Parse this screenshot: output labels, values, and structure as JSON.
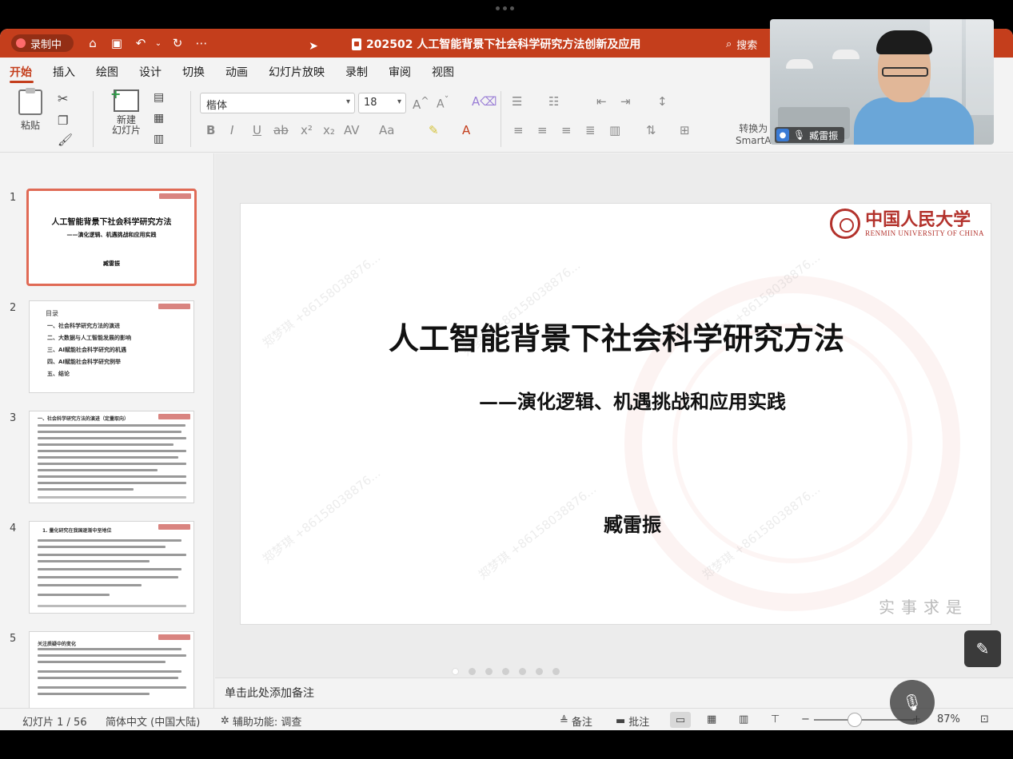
{
  "titlebar": {
    "recording_label": "录制中",
    "doc_title": "202502 人工智能背景下社会科学研究方法创新及应用",
    "search_label": "搜索"
  },
  "tabs": [
    "开始",
    "插入",
    "绘图",
    "设计",
    "切换",
    "动画",
    "幻灯片放映",
    "录制",
    "审阅",
    "视图"
  ],
  "ribbon": {
    "paste_label": "粘贴",
    "new_slide_label": "新建\n幻灯片",
    "font_name": "楷体",
    "font_size": "18",
    "convert_label": "转换为",
    "smartart_label": "SmartA"
  },
  "video": {
    "participant_name": "臧雷振"
  },
  "thumbnails": [
    {
      "num": "1",
      "title": "人工智能背景下社会科学研究方法",
      "subtitle": "——演化逻辑、机遇挑战和应用实践",
      "author": "臧雷振"
    },
    {
      "num": "2",
      "title": "目录",
      "items": [
        "一、社会科学研究方法的演进",
        "二、大数据与人工智能发展的影响",
        "三、AI赋能社会科学研究的机遇",
        "四、AI赋能社会科学研究例举",
        "五、结论"
      ]
    },
    {
      "num": "3",
      "title": "一、社会科学研究方法的演进（定量取向）"
    },
    {
      "num": "4",
      "title": "1. 量化研究在我国逐渐中坚地位"
    },
    {
      "num": "5",
      "title": "关注质疑中的变化"
    }
  ],
  "slide": {
    "university_cn": "中国人民大学",
    "university_en": "RENMIN UNIVERSITY OF CHINA",
    "title": "人工智能背景下社会科学研究方法",
    "subtitle": "——演化逻辑、机遇挑战和应用实践",
    "author": "臧雷振",
    "motto": "实事求是",
    "watermark_name": "郑梦琪",
    "watermark_phone": "+8615803887​6..."
  },
  "notes_placeholder": "单击此处添加备注",
  "status": {
    "slide_counter": "幻灯片 1 / 56",
    "language": "简体中文 (中国大陆)",
    "accessibility": "辅助功能: 调查",
    "notes_label": "备注",
    "comments_label": "批注",
    "zoom_percent": "87%"
  },
  "colors": {
    "accent": "#c43e1c",
    "selected_thumb_border": "#e06a55",
    "university_red": "#b3322c"
  }
}
